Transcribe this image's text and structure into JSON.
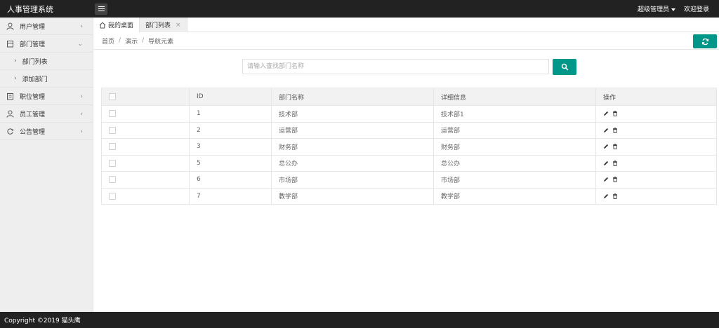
{
  "header": {
    "app_title": "人事管理系统",
    "user_label": "超级管理员",
    "welcome_label": "欢迎登录"
  },
  "sidebar": {
    "items": [
      {
        "label": "用户管理",
        "icon": "user-icon",
        "chevron": "<"
      },
      {
        "label": "部门管理",
        "icon": "department-icon",
        "chevron": "v"
      },
      {
        "label": "部门列表",
        "icon": "chevron-right-icon"
      },
      {
        "label": "添加部门",
        "icon": "chevron-right-icon"
      },
      {
        "label": "职位管理",
        "icon": "position-icon",
        "chevron": "<"
      },
      {
        "label": "员工管理",
        "icon": "employee-icon",
        "chevron": "<"
      },
      {
        "label": "公告管理",
        "icon": "notice-icon",
        "chevron": "<"
      }
    ]
  },
  "tabs": [
    {
      "label": "我的桌面",
      "icon": "home-icon"
    },
    {
      "label": "部门列表",
      "close": "×"
    }
  ],
  "breadcrumb": {
    "items": [
      "首页",
      "演示",
      "导航元素"
    ],
    "separator": "/"
  },
  "search": {
    "placeholder": "请输入查找部门名称"
  },
  "table": {
    "headers": [
      "",
      "ID",
      "部门名称",
      "详细信息",
      "操作"
    ],
    "rows": [
      {
        "id": "1",
        "name": "技术部",
        "detail": "技术部1"
      },
      {
        "id": "2",
        "name": "运营部",
        "detail": "运营部"
      },
      {
        "id": "3",
        "name": "财务部",
        "detail": "财务部"
      },
      {
        "id": "5",
        "name": "总公办",
        "detail": "总公办"
      },
      {
        "id": "6",
        "name": "市场部",
        "detail": "市场部"
      },
      {
        "id": "7",
        "name": "教学部",
        "detail": "教学部"
      }
    ]
  },
  "footer": {
    "copyright": "Copyright ©2019 猫头鹰"
  },
  "colors": {
    "accent": "#009688",
    "topbar": "#222222",
    "sidebar": "#eeeeee"
  }
}
